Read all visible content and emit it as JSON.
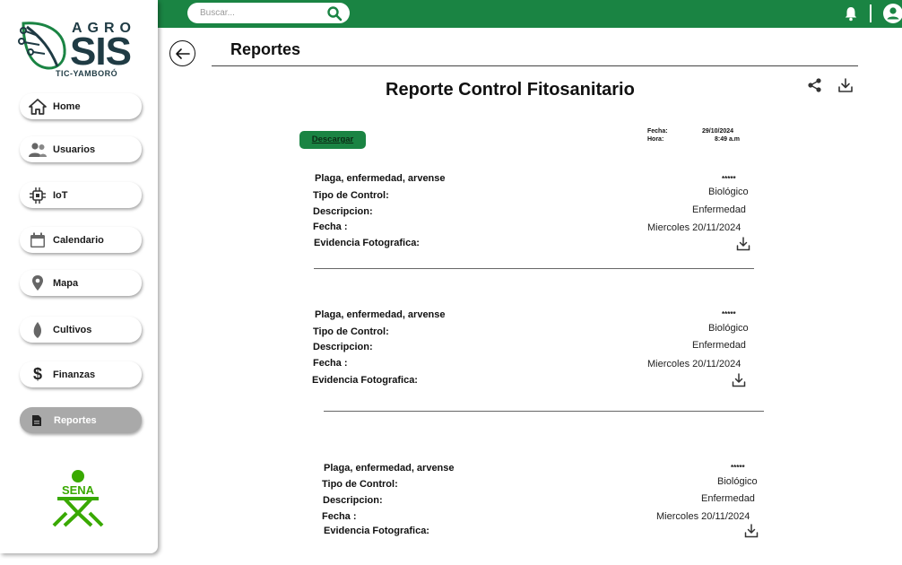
{
  "topbar": {
    "search_placeholder": "Buscar...",
    "brand_color": "#1a8443"
  },
  "logo": {
    "agro": "AGRO",
    "sis": "SIS",
    "tagline": "TIC-YAMBORÓ"
  },
  "sidebar": {
    "items": [
      {
        "label": "Home",
        "icon": "home-icon"
      },
      {
        "label": "Usuarios",
        "icon": "users-icon"
      },
      {
        "label": "IoT",
        "icon": "chip-icon"
      },
      {
        "label": "Calendario",
        "icon": "calendar-icon"
      },
      {
        "label": "Mapa",
        "icon": "map-pin-icon"
      },
      {
        "label": "Cultivos",
        "icon": "leaf-icon"
      },
      {
        "label": "Finanzas",
        "icon": "dollar-icon"
      },
      {
        "label": "Reportes",
        "icon": "report-icon",
        "active": true
      }
    ],
    "footer_logo": "SENA"
  },
  "header": {
    "title": "Reportes"
  },
  "report": {
    "title": "Reporte Control Fitosanitario",
    "download_label": "Descargar",
    "fecha_label": "Fecha:",
    "fecha_value": "29/10/2024",
    "hora_label": "Hora:",
    "hora_value": "8:49 a.m",
    "entries": [
      {
        "plaga_label": "Plaga, enfermedad, arvense",
        "plaga_value": "*****",
        "tipo_label": "Tipo de Control:",
        "tipo_value": "Biológico",
        "desc_label": "Descripcion:",
        "desc_value": "Enfermedad",
        "fecha_label": "Fecha :",
        "fecha_value": "Miercoles 20/11/2024",
        "evidencia_label": "Evidencia Fotografica:"
      },
      {
        "plaga_label": "Plaga, enfermedad, arvense",
        "plaga_value": "*****",
        "tipo_label": "Tipo de Control:",
        "tipo_value": "Biológico",
        "desc_label": "Descripcion:",
        "desc_value": "Enfermedad",
        "fecha_label": "Fecha :",
        "fecha_value": "Miercoles 20/11/2024",
        "evidencia_label": "Evidencia Fotografica:"
      },
      {
        "plaga_label": "Plaga, enfermedad, arvense",
        "plaga_value": "*****",
        "tipo_label": "Tipo de Control:",
        "tipo_value": "Biológico",
        "desc_label": "Descripcion:",
        "desc_value": "Enfermedad",
        "fecha_label": "Fecha :",
        "fecha_value": "Miercoles 20/11/2024",
        "evidencia_label": "Evidencia Fotografica:"
      }
    ]
  }
}
